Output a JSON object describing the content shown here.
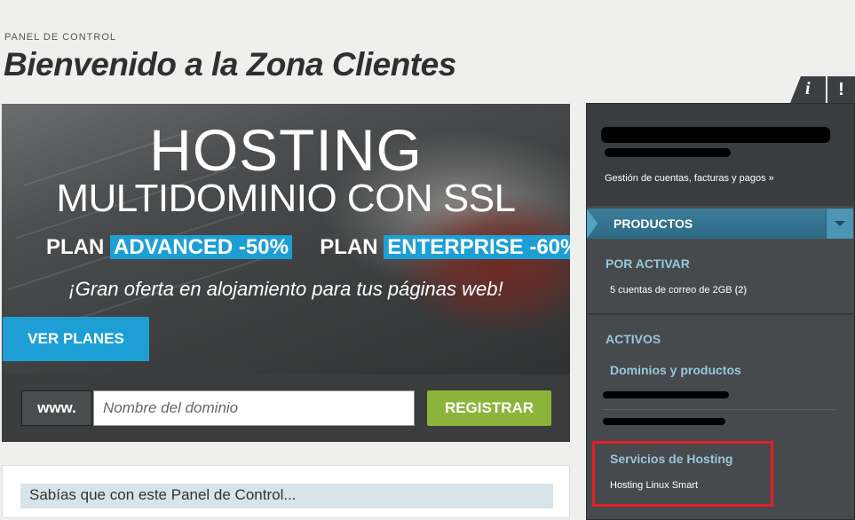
{
  "header": {
    "kicker": "PANEL DE CONTROL",
    "title": "Bienvenido a la Zona Clientes"
  },
  "banner": {
    "line1": "HOSTING",
    "line2": "MULTIDOMINIO CON SSL",
    "plan_word": "PLAN",
    "plan1_highlight": "ADVANCED -50%",
    "plan2_highlight": "ENTERPRISE -60%",
    "offer": "¡Gran oferta en alojamiento para tus páginas web!",
    "cta": "VER PLANES"
  },
  "domain_search": {
    "prefix": "www.",
    "placeholder": "Nombre del dominio",
    "value": "",
    "button": "REGISTRAR"
  },
  "tips": {
    "heading": "Sabías que con este Panel de Control..."
  },
  "side_tabs": {
    "info": "i",
    "alert": "!"
  },
  "account": {
    "manage_link": "Gestión de cuentas, facturas y pagos »"
  },
  "products": {
    "label": "PRODUCTOS",
    "pending": {
      "heading": "POR ACTIVAR",
      "item": "5 cuentas de correo de 2GB",
      "count": "(2)"
    },
    "active": {
      "heading": "ACTIVOS",
      "domains_heading": "Dominios y productos",
      "hosting_heading": "Servicios de Hosting",
      "hosting_item": "Hosting Linux Smart"
    }
  },
  "colors": {
    "accent_blue": "#1d9fd6",
    "register_green": "#8bb53a",
    "highlight_red": "#e21f26"
  }
}
